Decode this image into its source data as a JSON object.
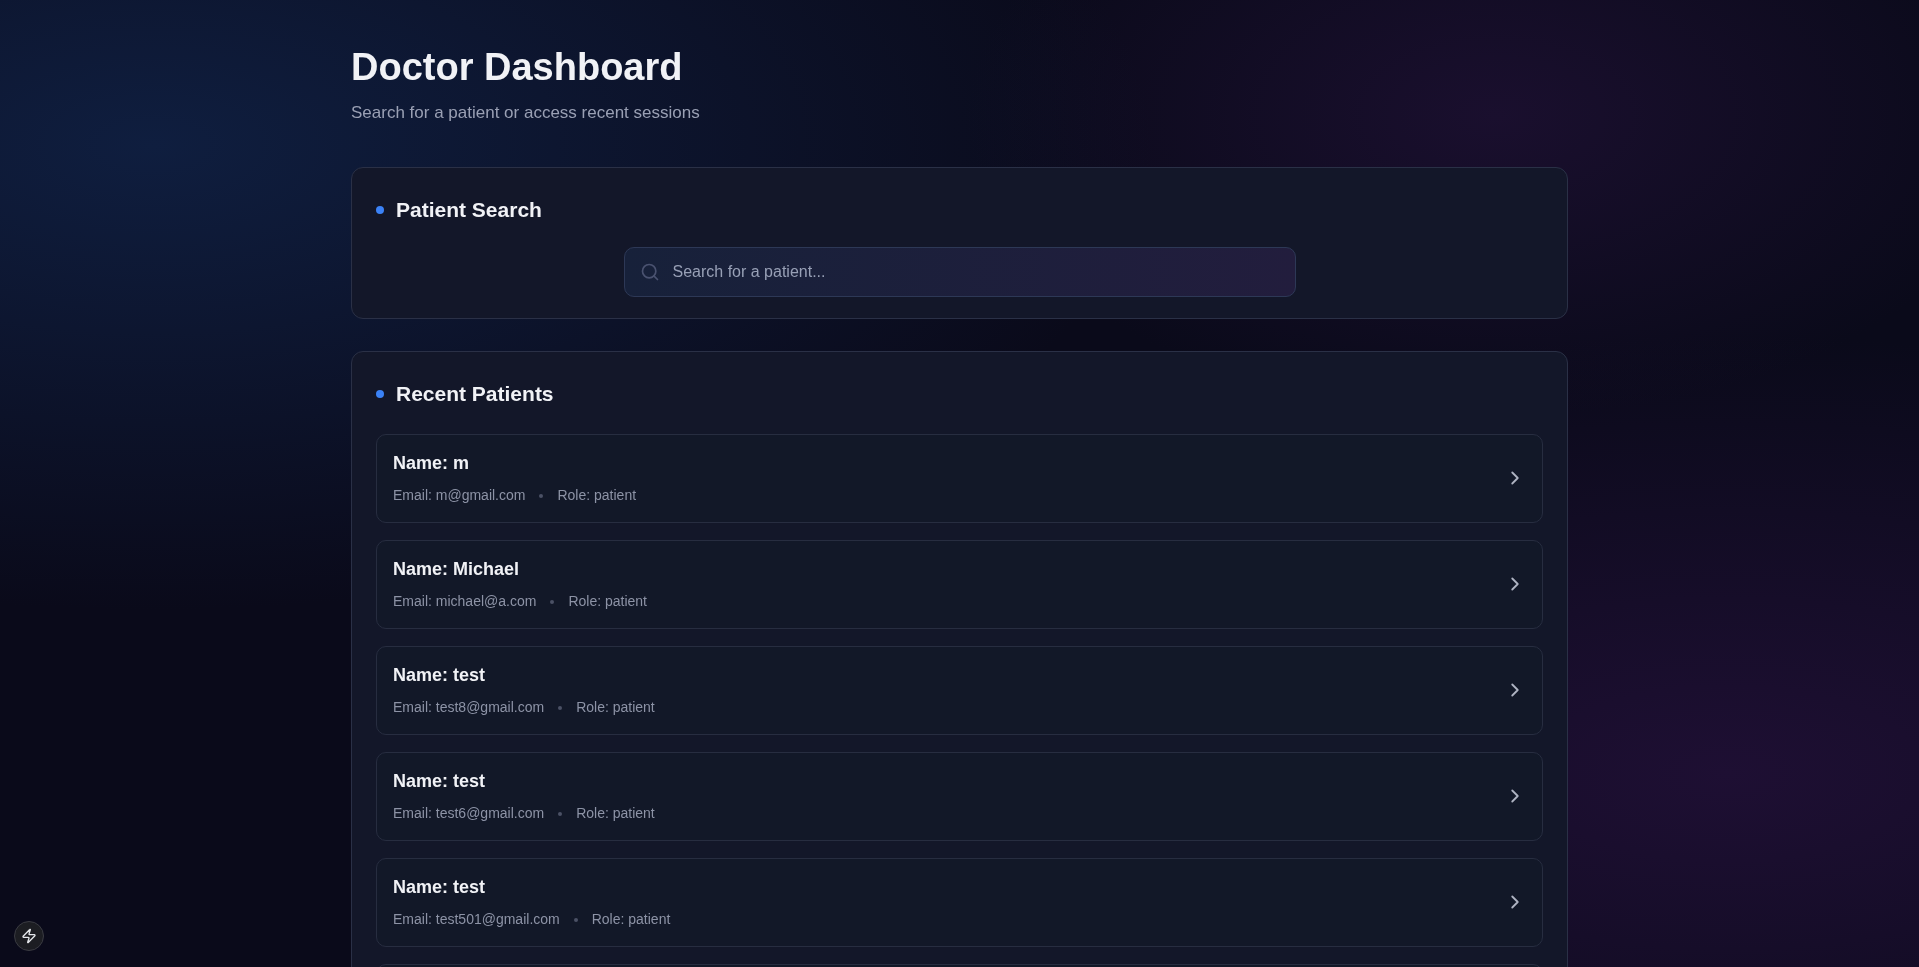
{
  "header": {
    "title": "Doctor Dashboard",
    "subtitle": "Search for a patient or access recent sessions"
  },
  "search_card": {
    "title": "Patient Search",
    "search": {
      "placeholder": "Search for a patient..."
    }
  },
  "recent_card": {
    "title": "Recent Patients",
    "patients": [
      {
        "name": "Name: m",
        "email": "Email: m@gmail.com",
        "role": "Role: patient"
      },
      {
        "name": "Name: Michael",
        "email": "Email: michael@a.com",
        "role": "Role: patient"
      },
      {
        "name": "Name: test",
        "email": "Email: test8@gmail.com",
        "role": "Role: patient"
      },
      {
        "name": "Name: test",
        "email": "Email: test6@gmail.com",
        "role": "Role: patient"
      },
      {
        "name": "Name: test",
        "email": "Email: test501@gmail.com",
        "role": "Role: patient"
      }
    ]
  }
}
